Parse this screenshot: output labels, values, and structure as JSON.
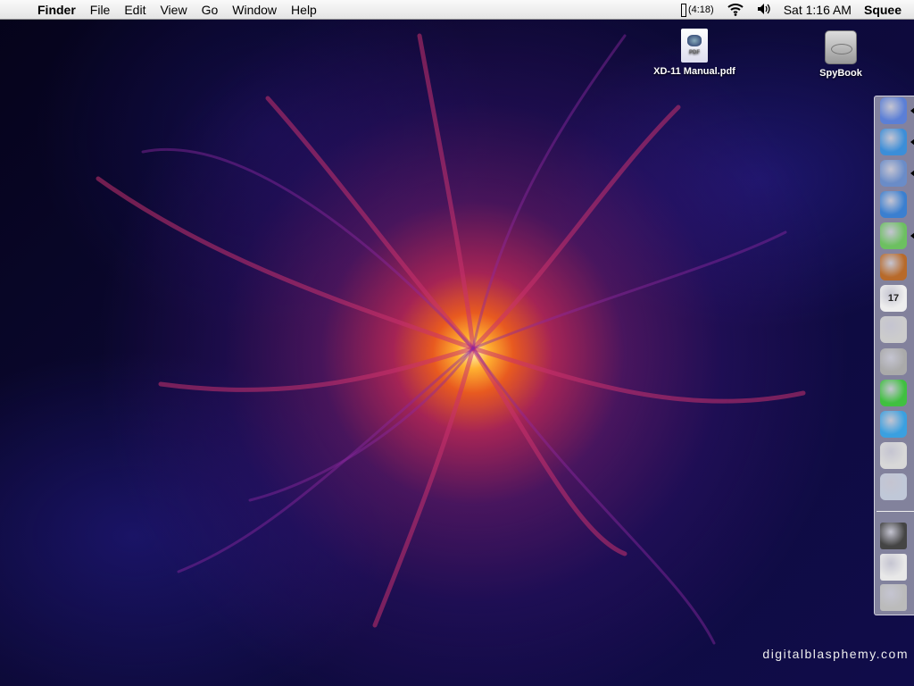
{
  "menubar": {
    "app": "Finder",
    "items": [
      "File",
      "Edit",
      "View",
      "Go",
      "Window",
      "Help"
    ],
    "battery": "(4:18)",
    "clock": "Sat 1:16 AM",
    "user": "Squee"
  },
  "desktop": {
    "icons": [
      {
        "label": "XD-11 Manual.pdf",
        "badge": "PDF"
      },
      {
        "label": "SpyBook"
      }
    ]
  },
  "dock": {
    "items": [
      {
        "name": "finder",
        "running": true,
        "color": "#5b7fd6"
      },
      {
        "name": "safari",
        "running": true,
        "color": "#3c8ed8"
      },
      {
        "name": "mail",
        "running": true,
        "color": "#6a8cc8"
      },
      {
        "name": "ichat",
        "running": false,
        "color": "#3a7fd0"
      },
      {
        "name": "itunes",
        "running": true,
        "color": "#6cc060"
      },
      {
        "name": "iphoto",
        "running": false,
        "color": "#b86a2a"
      },
      {
        "name": "ical",
        "running": false,
        "color": "#eeeeee",
        "text": "17"
      },
      {
        "name": "preview",
        "running": false,
        "color": "#cccccc"
      },
      {
        "name": "calculator",
        "running": false,
        "color": "#aaaaaa"
      },
      {
        "name": "app-green",
        "running": false,
        "color": "#40c040"
      },
      {
        "name": "app-w",
        "running": false,
        "color": "#3aa0e0"
      },
      {
        "name": "app-toaster",
        "running": false,
        "color": "#d8d8d8"
      },
      {
        "name": "app-dial",
        "running": false,
        "color": "#c0c8d8"
      },
      {
        "name": "document-window-1",
        "running": false,
        "color": "#444444"
      },
      {
        "name": "document-window-2",
        "running": false,
        "color": "#e8e8e8"
      },
      {
        "name": "trash",
        "running": false,
        "color": "#bbbbbb"
      }
    ]
  },
  "watermark": "digitalblasphemy.com"
}
